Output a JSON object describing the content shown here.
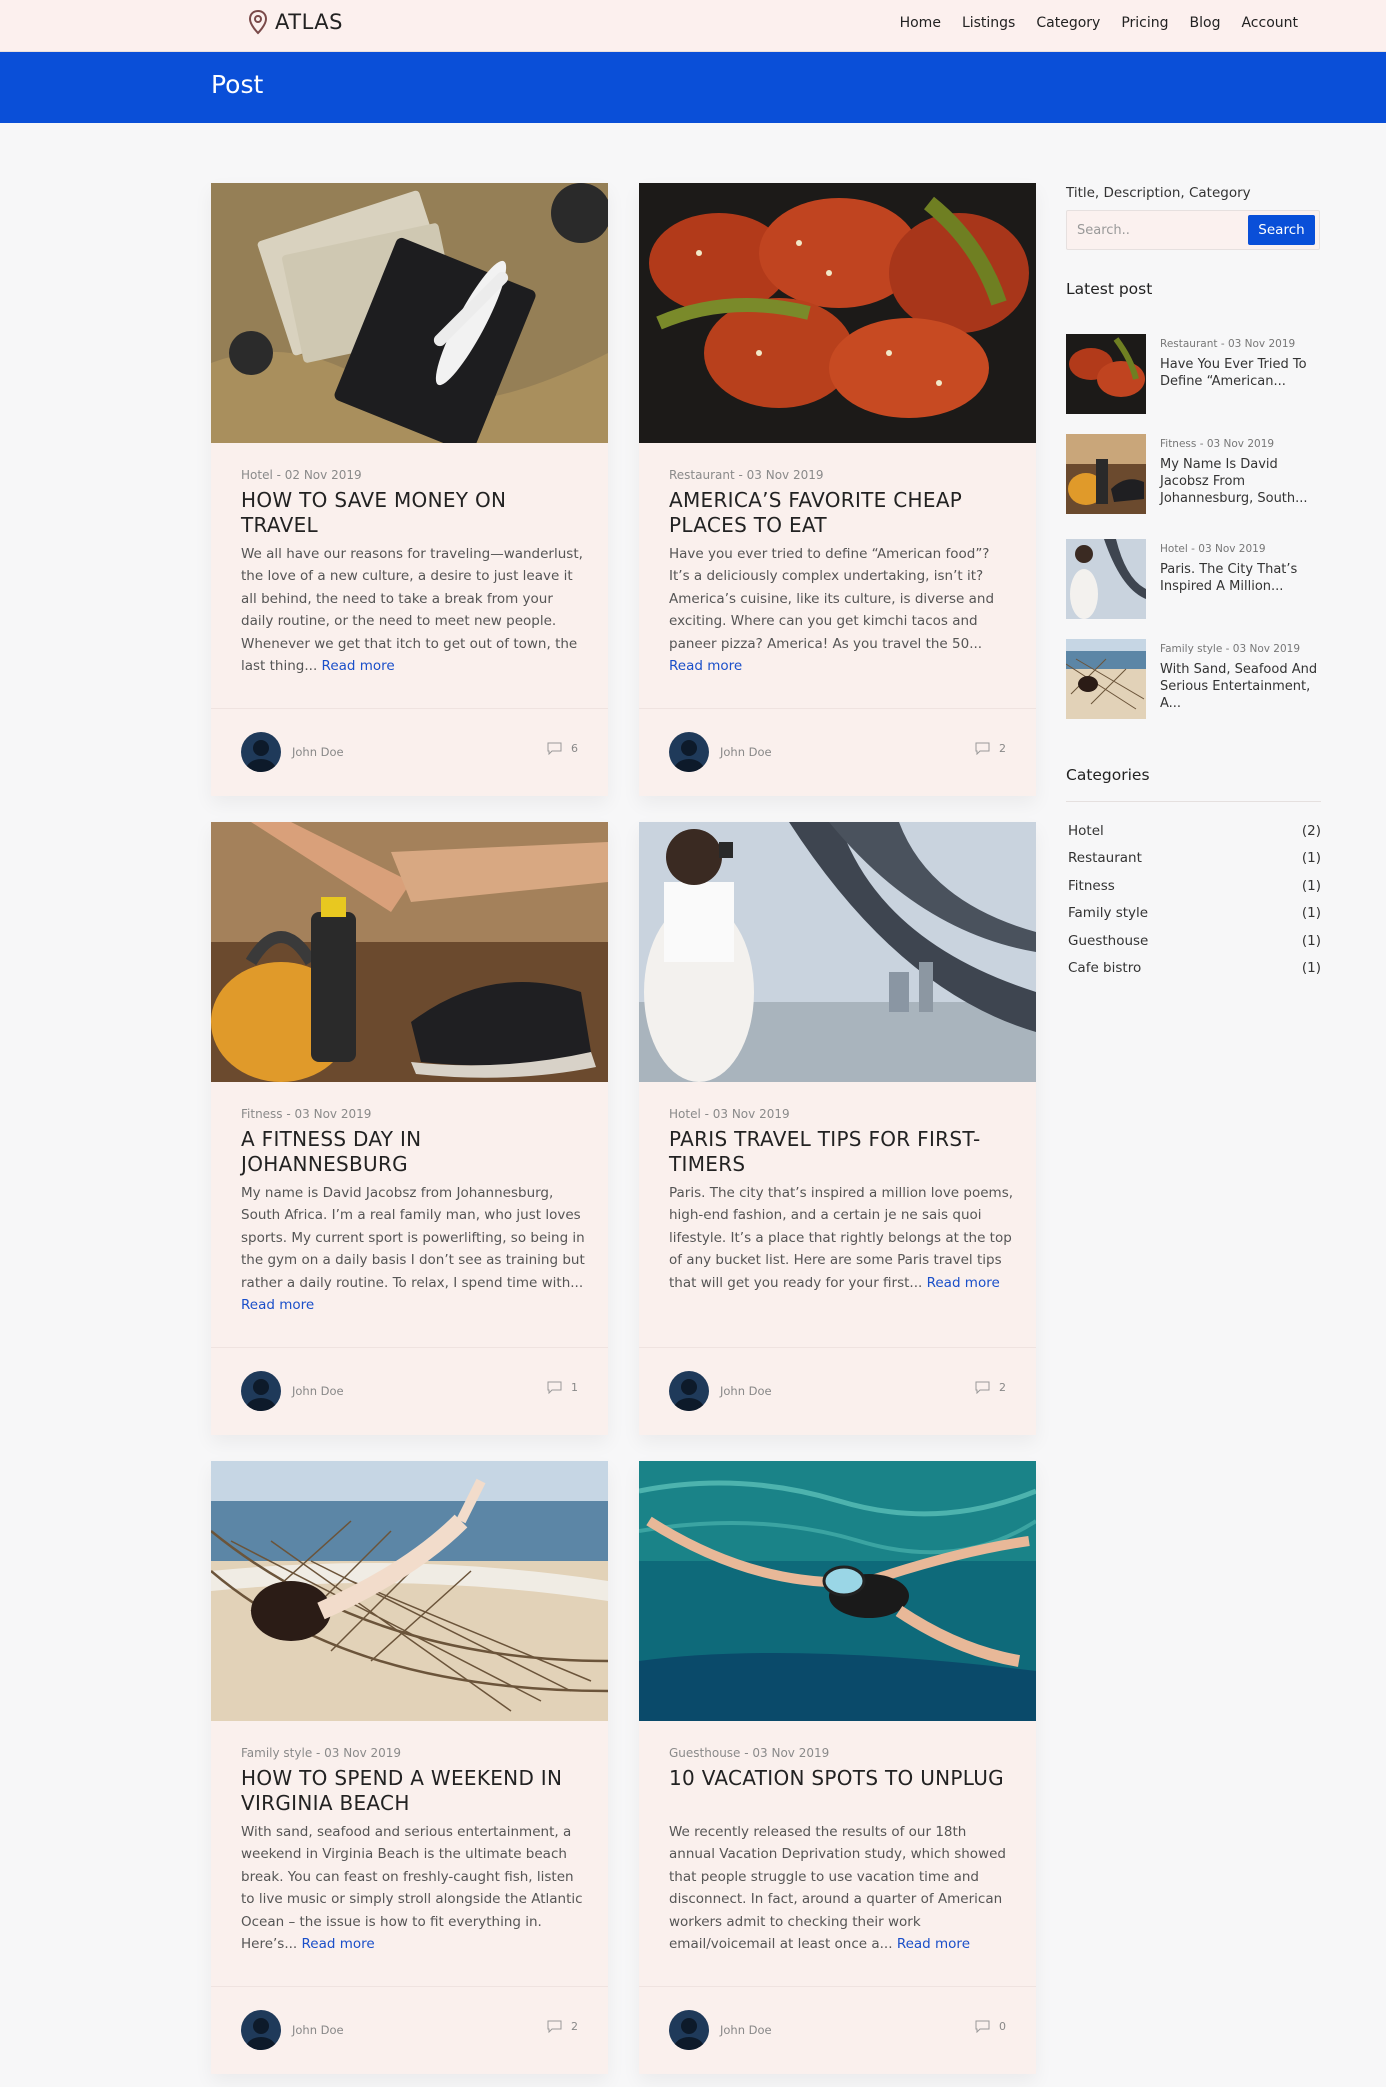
{
  "brand": {
    "name": "ATLAS"
  },
  "nav": [
    "Home",
    "Listings",
    "Category",
    "Pricing",
    "Blog",
    "Account"
  ],
  "banner": {
    "title": "Post"
  },
  "posts": [
    {
      "meta": "Hotel - 02 Nov 2019",
      "title": "HOW TO SAVE MONEY ON TRAVEL",
      "excerpt": "We all have our reasons for traveling—wanderlust, the love of a new culture, a desire to just leave it all behind, the need to take a break from your daily routine, or the need to meet new people. Whenever we get that itch to get out of town, the last thing...",
      "read_more": "Read more",
      "author": "John Doe",
      "comments": "6"
    },
    {
      "meta": "Restaurant - 03 Nov 2019",
      "title": "AMERICA’S FAVORITE CHEAP PLACES TO EAT",
      "excerpt": "Have you ever tried to define “American food”? It’s a deliciously complex undertaking, isn’t it? America’s cuisine, like its culture, is diverse and exciting. Where can you get kimchi tacos and paneer pizza? America! As you travel the 50...",
      "read_more": "Read more",
      "author": "John Doe",
      "comments": "2"
    },
    {
      "meta": "Fitness - 03 Nov 2019",
      "title": "A FITNESS DAY IN JOHANNESBURG",
      "excerpt": "My name is David Jacobsz from Johannesburg, South Africa. I’m a real family man, who just loves sports. My current sport is powerlifting, so being in the gym on a daily basis I don’t see as training but rather a daily routine. To relax, I spend time with...",
      "read_more": "Read more",
      "author": "John Doe",
      "comments": "1"
    },
    {
      "meta": "Hotel - 03 Nov 2019",
      "title": "PARIS TRAVEL TIPS FOR FIRST-TIMERS",
      "excerpt": "Paris. The city that’s inspired a million love poems, high-end fashion, and a certain je ne sais quoi lifestyle. It’s a place that rightly belongs at the top of any bucket list. Here are some Paris travel tips that will get you ready for your first...",
      "read_more": "Read more",
      "author": "John Doe",
      "comments": "2"
    },
    {
      "meta": "Family style - 03 Nov 2019",
      "title": "HOW TO SPEND A WEEKEND IN VIRGINIA BEACH",
      "excerpt": "With sand, seafood and serious entertainment, a weekend in Virginia Beach is the ultimate beach break. You can feast on freshly-caught fish, listen to live music or simply stroll alongside the Atlantic Ocean – the issue is how to fit everything in. Here’s...",
      "read_more": "Read more",
      "author": "John Doe",
      "comments": "2"
    },
    {
      "meta": "Guesthouse - 03 Nov 2019",
      "title": "10 VACATION SPOTS TO UNPLUG",
      "excerpt": "We recently released the results of our 18th annual Vacation Deprivation study, which showed that people struggle to use vacation time and disconnect. In fact, around a quarter of American workers admit to checking their work email/voicemail at least once a...",
      "read_more": "Read more",
      "author": "John Doe",
      "comments": "0"
    }
  ],
  "sidebar": {
    "search_label": "Title, Description, Category",
    "search_placeholder": "Search..",
    "search_button": "Search",
    "latest_title": "Latest post",
    "latest": [
      {
        "meta": "Restaurant - 03 Nov 2019",
        "title": "Have You Ever Tried To Define “American..."
      },
      {
        "meta": "Fitness - 03 Nov 2019",
        "title": "My Name Is David Jacobsz From Johannesburg, South..."
      },
      {
        "meta": "Hotel - 03 Nov 2019",
        "title": "Paris. The City That’s Inspired A Million..."
      },
      {
        "meta": "Family style - 03 Nov 2019",
        "title": "With Sand, Seafood And Serious Entertainment, A..."
      }
    ],
    "categories_title": "Categories",
    "categories": [
      {
        "name": "Hotel",
        "count": "(2)"
      },
      {
        "name": "Restaurant",
        "count": "(1)"
      },
      {
        "name": "Fitness",
        "count": "(1)"
      },
      {
        "name": "Family style",
        "count": "(1)"
      },
      {
        "name": "Guesthouse",
        "count": "(1)"
      },
      {
        "name": "Cafe bistro",
        "count": "(1)"
      }
    ]
  },
  "colors": {
    "accent": "#0a4fd8",
    "card_bg": "#faf0ed",
    "link": "#1a4fc9",
    "nav_bg": "#fcf0ee"
  },
  "icons": {
    "logo": "map-pin-icon",
    "comments": "comment-bubble-icon"
  }
}
